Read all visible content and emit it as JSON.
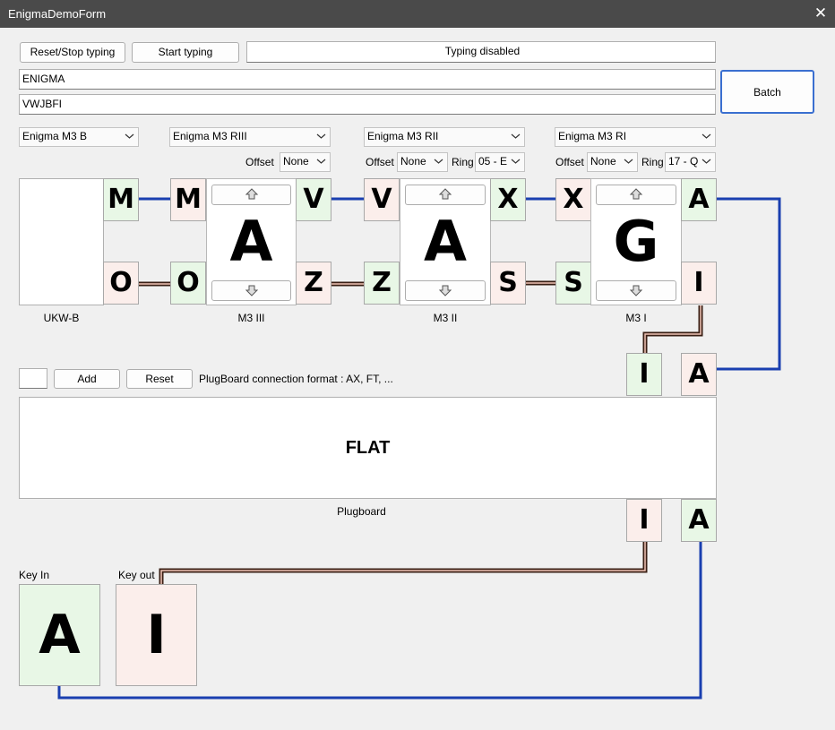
{
  "window": {
    "title": "EnigmaDemoForm",
    "close_glyph": "✕"
  },
  "toolbar": {
    "reset_label": "Reset/Stop typing",
    "start_label": "Start typing",
    "status": "Typing disabled",
    "batch_label": "Batch"
  },
  "input_text": "ENIGMA",
  "output_text": "VWJBFI",
  "reflector": {
    "model": "Enigma M3 B",
    "label": "UKW-B",
    "top_letter": "M",
    "bottom_letter": "O"
  },
  "rotors": [
    {
      "model": "Enigma M3 RIII",
      "offset_label": "Offset",
      "offset": "None",
      "window_letter": "A",
      "label": "M3 III",
      "left_top": "M",
      "left_bottom": "O",
      "right_top": "V",
      "right_bottom": "Z"
    },
    {
      "model": "Enigma M3 RII",
      "offset_label": "Offset",
      "offset": "None",
      "ring_label": "Ring",
      "ring": "05 - E",
      "window_letter": "A",
      "label": "M3 II",
      "left_top": "V",
      "left_bottom": "Z",
      "right_top": "X",
      "right_bottom": "S"
    },
    {
      "model": "Enigma M3 RI",
      "offset_label": "Offset",
      "offset": "None",
      "ring_label": "Ring",
      "ring": "17 - Q",
      "window_letter": "G",
      "label": "M3 I",
      "left_top": "X",
      "left_bottom": "S",
      "right_top": "A",
      "right_bottom": "I"
    }
  ],
  "plugboard": {
    "add_label": "Add",
    "reset_label": "Reset",
    "input_value": "",
    "format_hint": "PlugBoard connection format : AX, FT, ...",
    "state": "FLAT",
    "label": "Plugboard",
    "top_left": "I",
    "top_right": "A",
    "bottom_left": "I",
    "bottom_right": "A"
  },
  "key_in": {
    "label": "Key In",
    "letter": "A"
  },
  "key_out": {
    "label": "Key out",
    "letter": "I"
  },
  "colors": {
    "signal_in": "#1a3fb0",
    "signal_out": "#3a1f14",
    "signal_out_core": "#f2c6b8",
    "in_box": "#e8f7e6",
    "out_box": "#fbeeeb"
  },
  "icons": {
    "combo_arrow": "chevron-down-icon",
    "rotor_up": "arrow-up-icon",
    "rotor_down": "arrow-down-icon"
  }
}
